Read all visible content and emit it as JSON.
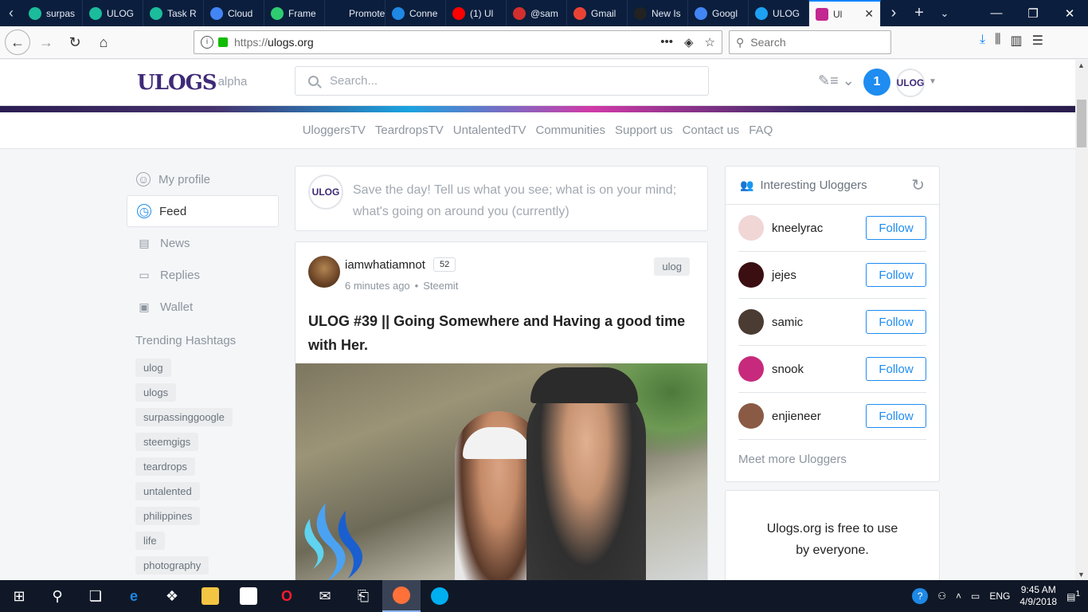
{
  "browser": {
    "tabs": [
      {
        "label": "surpas",
        "color": "#1bbc9b"
      },
      {
        "label": "ULOG",
        "color": "#1bbc9b"
      },
      {
        "label": "Task R",
        "color": "#1bbc9b"
      },
      {
        "label": "Cloud",
        "color": "#4285f4"
      },
      {
        "label": "Frame",
        "color": "#2ecc71"
      },
      {
        "label": "Promote y",
        "color": "#0b1e3d"
      },
      {
        "label": "Conne",
        "color": "#1e88e5"
      },
      {
        "label": "(1) Ul",
        "color": "#ff0000"
      },
      {
        "label": "@sam",
        "color": "#d32f2f"
      },
      {
        "label": "Gmail",
        "color": "#ea4335"
      },
      {
        "label": "New Is",
        "color": "#222222"
      },
      {
        "label": "Googl",
        "color": "#4285f4"
      },
      {
        "label": "ULOG",
        "color": "#1da1f2"
      }
    ],
    "active_tab": {
      "label": "Ul",
      "color": "#c2288f"
    },
    "url_scheme": "https://",
    "url_host": "ulogs.org",
    "search_placeholder": "Search"
  },
  "site": {
    "logo_text": "ULOGS",
    "logo_badge": "alpha",
    "search_placeholder": "Search...",
    "notifications_count": "1",
    "avatar_text": "ULOG",
    "nav": [
      "UloggersTV",
      "TeardropsTV",
      "UntalentedTV",
      "Communities",
      "Support us",
      "Contact us",
      "FAQ"
    ]
  },
  "sidebar": {
    "items": [
      {
        "label": "My profile",
        "icon": "user-circle-icon"
      },
      {
        "label": "Feed",
        "icon": "clock-icon"
      },
      {
        "label": "News",
        "icon": "news-icon"
      },
      {
        "label": "Replies",
        "icon": "replies-icon"
      },
      {
        "label": "Wallet",
        "icon": "wallet-icon"
      }
    ],
    "hashtags_title": "Trending Hashtags",
    "hashtags": [
      "ulog",
      "ulogs",
      "surpassinggoogle",
      "steemgigs",
      "teardrops",
      "untalented",
      "philippines",
      "life",
      "photography"
    ]
  },
  "composer": {
    "placeholder": "Save the day! Tell us what you see; what is on your mind; what's going on around you (currently)"
  },
  "post": {
    "author": "iamwhatiamnot",
    "reputation": "52",
    "time": "6 minutes ago",
    "source": "Steemit",
    "tag": "ulog",
    "title": "ULOG #39 || Going Somewhere and Having a good time with Her."
  },
  "right": {
    "title": "Interesting Uloggers",
    "users": [
      {
        "name": "kneelyrac",
        "avatar_color": "#f1d6d6"
      },
      {
        "name": "jejes",
        "avatar_color": "#3b0f12"
      },
      {
        "name": "samic",
        "avatar_color": "#4a3b33"
      },
      {
        "name": "snook",
        "avatar_color": "#c72a7c"
      },
      {
        "name": "enjieneer",
        "avatar_color": "#8a5a44"
      }
    ],
    "follow_label": "Follow",
    "more_label": "Meet more Uloggers",
    "free_text": "Ulogs.org is free to use by everyone."
  },
  "taskbar": {
    "lang": "ENG",
    "time": "9:45 AM",
    "date": "4/9/2018",
    "notif_count": "1"
  }
}
